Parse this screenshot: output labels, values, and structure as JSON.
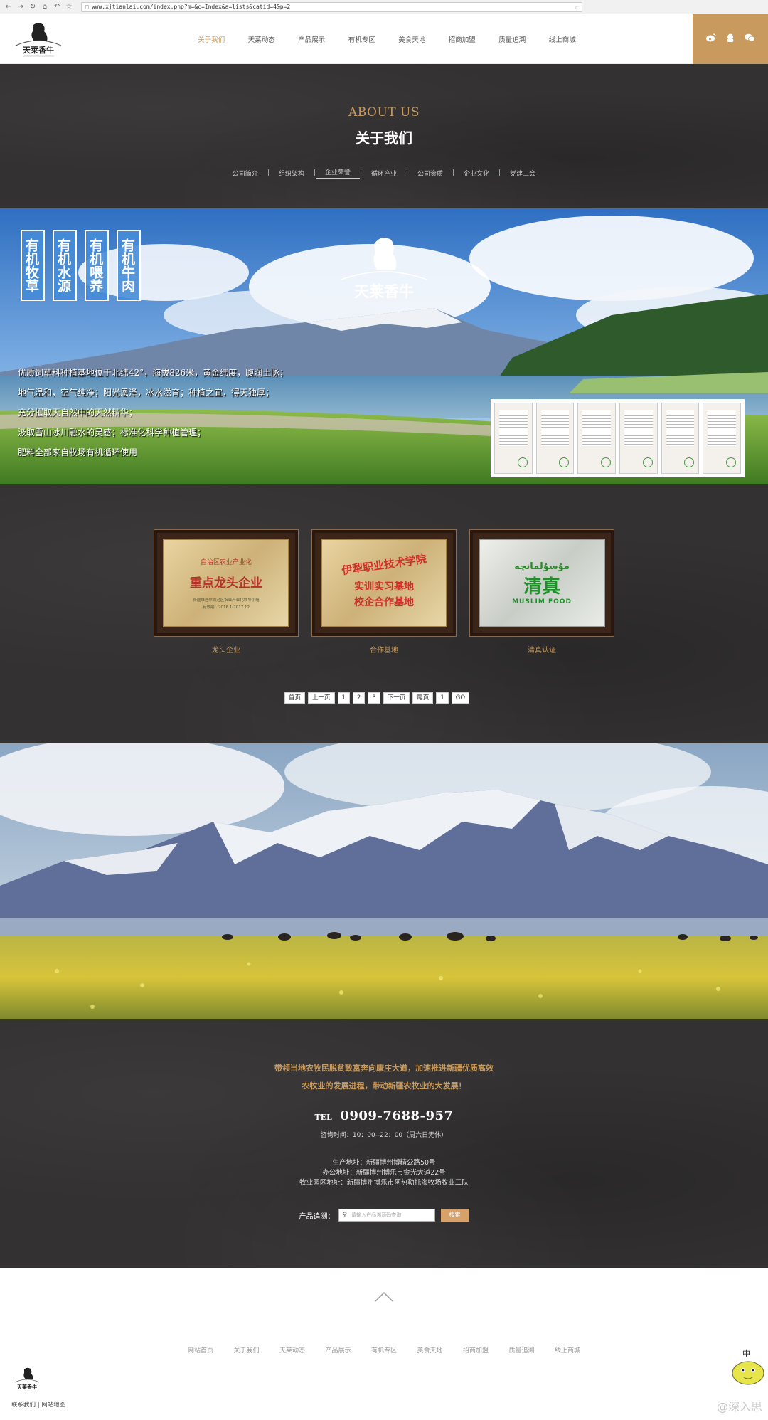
{
  "browser": {
    "url": "www.xjtianlai.com/index.php?m=&c=Index&a=lists&catid=4&p=2"
  },
  "header": {
    "logo_text": "天莱香牛",
    "nav": [
      "关于我们",
      "天莱动态",
      "产品展示",
      "有机专区",
      "美食天地",
      "招商加盟",
      "质量追溯",
      "线上商城"
    ]
  },
  "about": {
    "title_en": "ABOUT US",
    "title_cn": "关于我们",
    "subnav": [
      "公司简介",
      "组织架构",
      "企业荣誉",
      "循环产业",
      "公司资质",
      "企业文化",
      "党建工会"
    ]
  },
  "banner": {
    "badges": [
      "有机牧草",
      "有机水源",
      "有机喂养",
      "有机牛肉"
    ],
    "logo_text": "天莱香牛",
    "lines": [
      "优质饲草料种植基地位于北纬42°，海拔826米，黄金纬度，腹润土脉；",
      "地气温和，空气纯净；阳光恩泽，冰水滋育；种植之宜，得天独厚；",
      "充分攫取天自然中的天然精华；",
      "汲取雪山冰川融水的灵感；标准化科学种植管理；",
      "肥料全部来自牧场有机循环使用"
    ]
  },
  "honors": {
    "items": [
      {
        "caption": "龙头企业",
        "top": "自治区农业产业化",
        "main": "重点龙头企业",
        "sub": "新疆维吾尔自治区农业产业化领导小组",
        "date": "有效期：2016.1-2017.12"
      },
      {
        "caption": "合作基地",
        "top": "伊犁职业技术学院",
        "main": "实训实习基地",
        "sub": "校企合作基地"
      },
      {
        "caption": "清真认证",
        "top": "مۇسۇلمانچە",
        "main": "清真",
        "sub": "MUSLIM FOOD"
      }
    ],
    "pagination": [
      "首页",
      "上一页",
      "1",
      "2",
      "3",
      "下一页",
      "尾页",
      "1",
      "GO"
    ]
  },
  "footer_info": {
    "slogan_1": "带领当地农牧民脱贫致富奔向康庄大道，加速推进新疆优质高效",
    "slogan_2": "农牧业的发展进程，带动新疆农牧业的大发展！",
    "tel_label": "TEL",
    "tel": "0909-7688-957",
    "hours": "咨询时间：10：00--22：00（周六日无休）",
    "addr_1": "生产地址：新疆博州博精公路50号",
    "addr_2": "办公地址：新疆博州博乐市金光大道22号",
    "addr_3": "牧业园区地址：新疆博州博乐市阿热勒托海牧场牧业三队",
    "search_label": "产品追溯：",
    "search_placeholder": "请输入产品溯源码查询",
    "search_button": "搜索"
  },
  "bottom": {
    "nav": [
      "网站首页",
      "关于我们",
      "天莱动态",
      "产品展示",
      "有机专区",
      "美食天地",
      "招商加盟",
      "质量追溯",
      "线上商城"
    ],
    "links": [
      "联系我们",
      "网站地图"
    ],
    "watermark": "@深入思"
  }
}
